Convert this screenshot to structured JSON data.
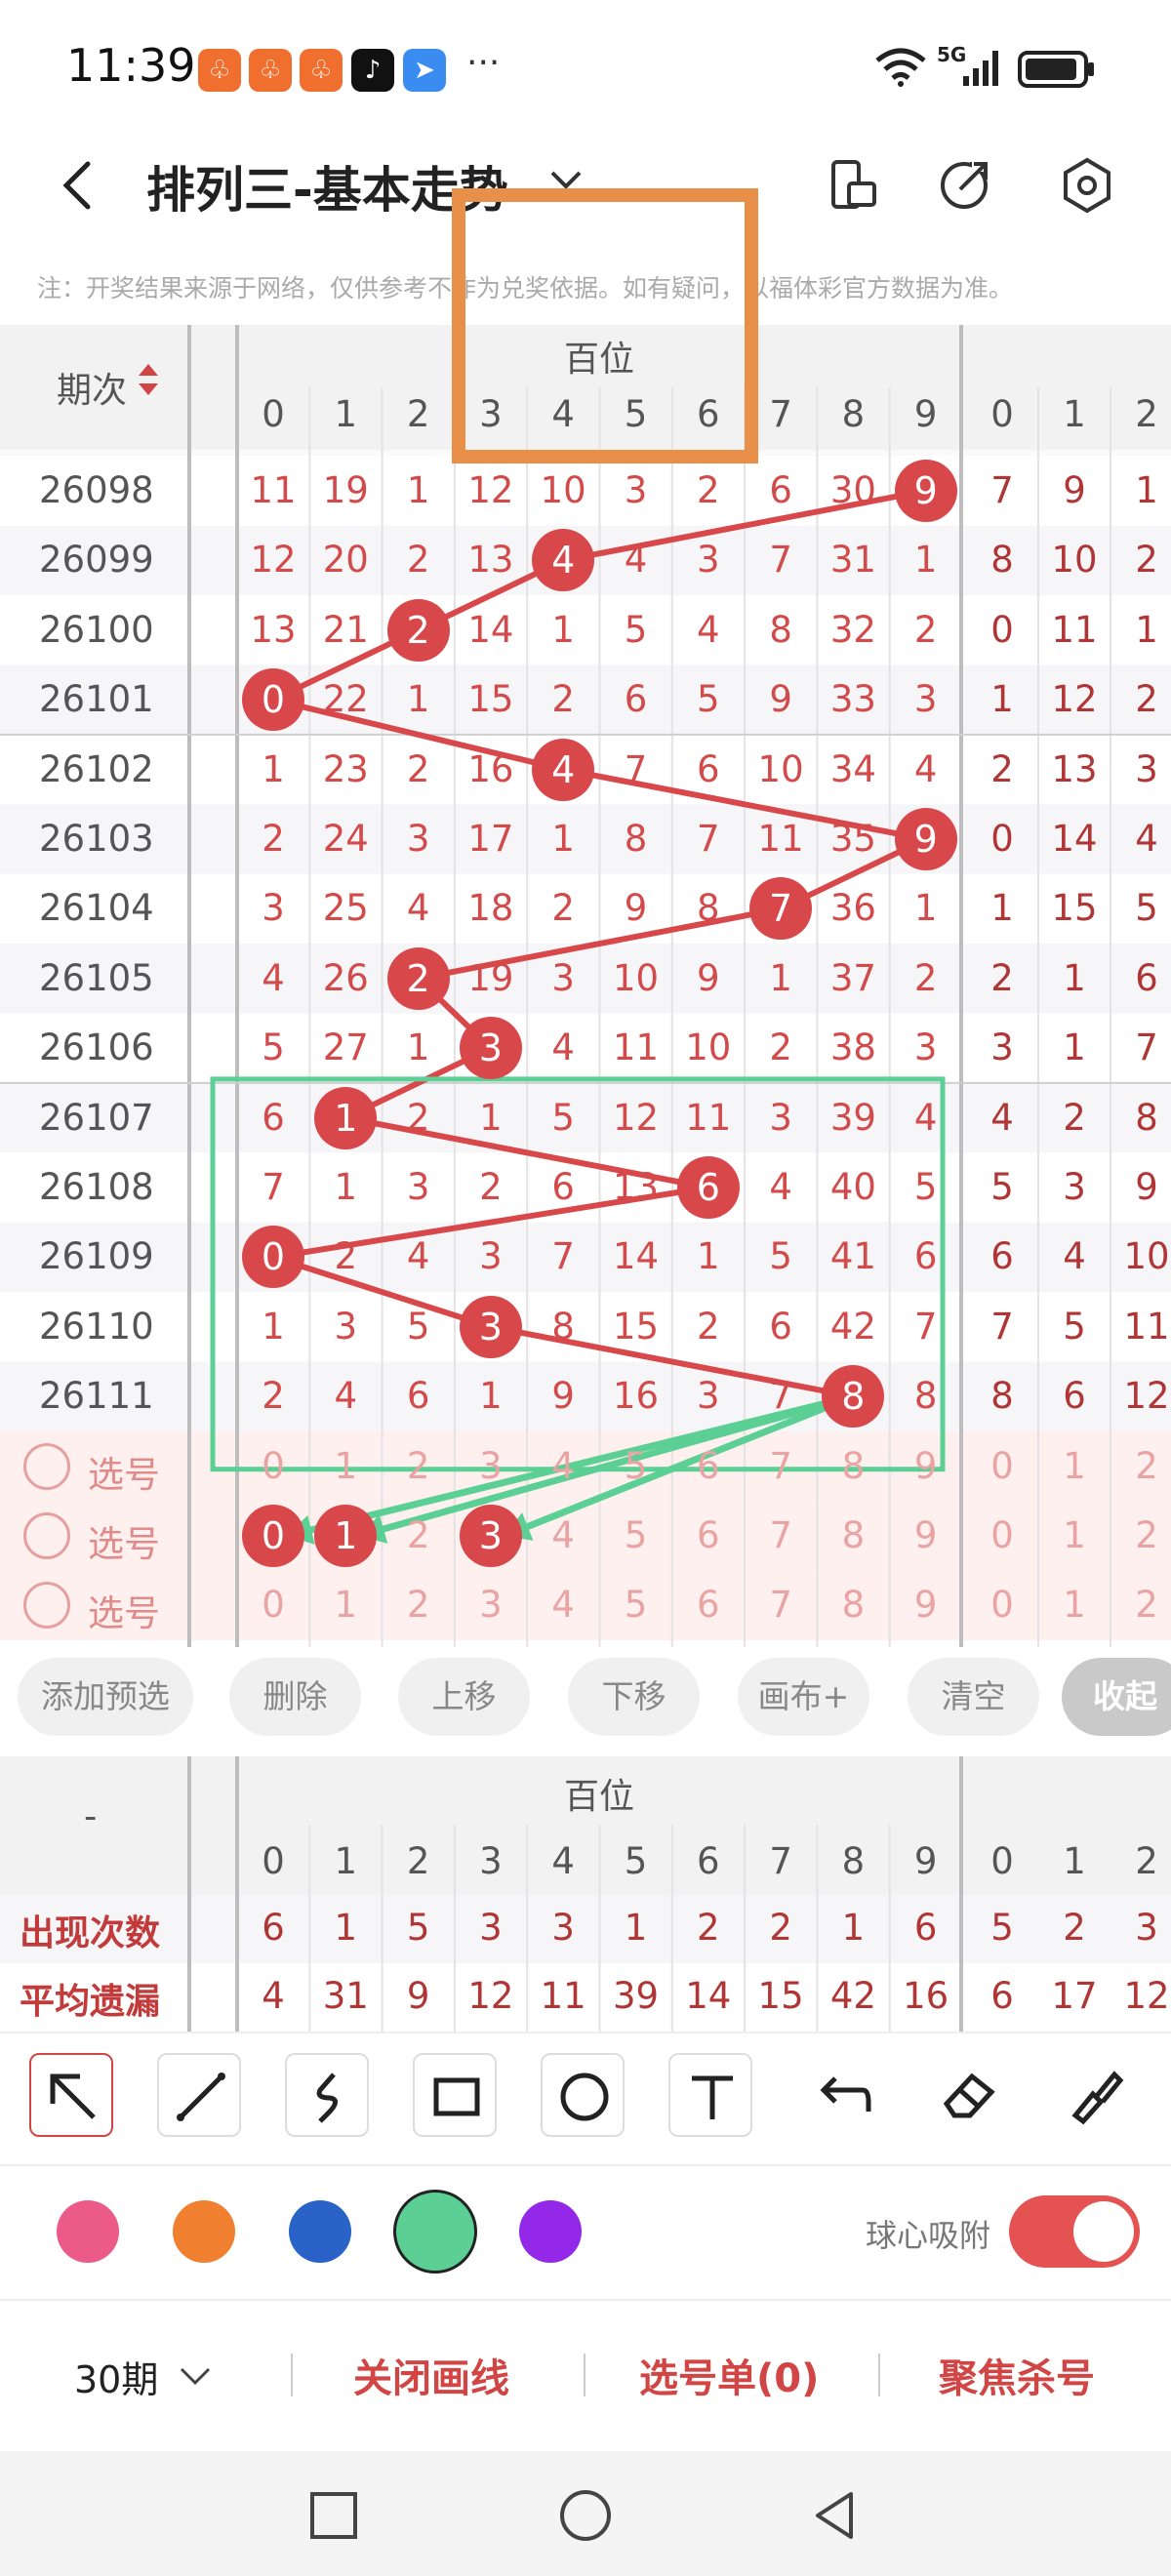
{
  "status_bar": {
    "time": "11:39",
    "more": "···",
    "network": "5G"
  },
  "header": {
    "title": "排列三-基本走势",
    "notice": "注：开奖结果来源于网络，仅供参考不作为兑奖依据。如有疑问，以福体彩官方数据为准。"
  },
  "table": {
    "period_header": "期次",
    "group_label": "百位",
    "digits": [
      "0",
      "1",
      "2",
      "3",
      "4",
      "5",
      "6",
      "7",
      "8",
      "9"
    ],
    "next_digits": [
      "0",
      "1",
      "2"
    ],
    "rows": [
      {
        "period": "26098",
        "cells": [
          "11",
          "19",
          "1",
          "12",
          "10",
          "3",
          "2",
          "6",
          "30",
          "9"
        ],
        "hit": 9,
        "next": [
          "7",
          "9",
          "1"
        ]
      },
      {
        "period": "26099",
        "cells": [
          "12",
          "20",
          "2",
          "13",
          "4",
          "4",
          "3",
          "7",
          "31",
          "1"
        ],
        "hit": 4,
        "next": [
          "8",
          "10",
          "2"
        ]
      },
      {
        "period": "26100",
        "cells": [
          "13",
          "21",
          "2",
          "14",
          "1",
          "5",
          "4",
          "8",
          "32",
          "2"
        ],
        "hit": 2,
        "next": [
          "0",
          "11",
          "1"
        ]
      },
      {
        "period": "26101",
        "cells": [
          "0",
          "22",
          "1",
          "15",
          "2",
          "6",
          "5",
          "9",
          "33",
          "3"
        ],
        "hit": 0,
        "next": [
          "1",
          "12",
          "2"
        ]
      },
      {
        "period": "26102",
        "cells": [
          "1",
          "23",
          "2",
          "16",
          "4",
          "7",
          "6",
          "10",
          "34",
          "4"
        ],
        "hit": 4,
        "next": [
          "2",
          "13",
          "3"
        ]
      },
      {
        "period": "26103",
        "cells": [
          "2",
          "24",
          "3",
          "17",
          "1",
          "8",
          "7",
          "11",
          "35",
          "9"
        ],
        "hit": 9,
        "next": [
          "0",
          "14",
          "4"
        ]
      },
      {
        "period": "26104",
        "cells": [
          "3",
          "25",
          "4",
          "18",
          "2",
          "9",
          "8",
          "7",
          "36",
          "1"
        ],
        "hit": 7,
        "next": [
          "1",
          "15",
          "5"
        ]
      },
      {
        "period": "26105",
        "cells": [
          "4",
          "26",
          "2",
          "19",
          "3",
          "10",
          "9",
          "1",
          "37",
          "2"
        ],
        "hit": 2,
        "next": [
          "2",
          "1",
          "6"
        ]
      },
      {
        "period": "26106",
        "cells": [
          "5",
          "27",
          "1",
          "3",
          "4",
          "11",
          "10",
          "2",
          "38",
          "3"
        ],
        "hit": 3,
        "next": [
          "3",
          "1",
          "7"
        ]
      },
      {
        "period": "26107",
        "cells": [
          "6",
          "1",
          "2",
          "1",
          "5",
          "12",
          "11",
          "3",
          "39",
          "4"
        ],
        "hit": 1,
        "next": [
          "4",
          "2",
          "8"
        ]
      },
      {
        "period": "26108",
        "cells": [
          "7",
          "1",
          "3",
          "2",
          "6",
          "13",
          "6",
          "4",
          "40",
          "5"
        ],
        "hit": 6,
        "next": [
          "5",
          "3",
          "9"
        ]
      },
      {
        "period": "26109",
        "cells": [
          "0",
          "2",
          "4",
          "3",
          "7",
          "14",
          "1",
          "5",
          "41",
          "6"
        ],
        "hit": 0,
        "next": [
          "6",
          "4",
          "10"
        ]
      },
      {
        "period": "26110",
        "cells": [
          "1",
          "3",
          "5",
          "3",
          "8",
          "15",
          "2",
          "6",
          "42",
          "7"
        ],
        "hit": 3,
        "next": [
          "7",
          "5",
          "11"
        ]
      },
      {
        "period": "26111",
        "cells": [
          "2",
          "4",
          "6",
          "1",
          "9",
          "16",
          "3",
          "7",
          "8",
          "8"
        ],
        "hit": 8,
        "next": [
          "8",
          "6",
          "12"
        ]
      }
    ],
    "select_label": "选号",
    "select_rows": [
      {
        "picked": []
      },
      {
        "picked": [
          0,
          1,
          3
        ]
      },
      {
        "picked": []
      }
    ]
  },
  "actions": {
    "add_preselect": "添加预选",
    "delete": "删除",
    "move_up": "上移",
    "move_down": "下移",
    "canvas_plus": "画布+",
    "clear": "清空",
    "collapse": "收起"
  },
  "stats": {
    "corner": "-",
    "group_label": "百位",
    "appear_label": "出现次数",
    "avg_miss_label": "平均遗漏",
    "appear": [
      "6",
      "1",
      "5",
      "3",
      "3",
      "1",
      "2",
      "2",
      "1",
      "6"
    ],
    "appear_next": [
      "5",
      "2",
      "3"
    ],
    "avg_miss": [
      "4",
      "31",
      "9",
      "12",
      "11",
      "39",
      "14",
      "15",
      "42",
      "16"
    ],
    "avg_miss_next": [
      "6",
      "17",
      "12"
    ]
  },
  "draw_toolbar": {
    "snap_label": "球心吸附",
    "colors": [
      "#ec5a8a",
      "#f08030",
      "#2a62c8",
      "#5ccf95",
      "#9428e8"
    ]
  },
  "bottom": {
    "periods": "30期",
    "close_lines": "关闭画线",
    "pick_list": "选号单(0)",
    "focus_kill": "聚焦杀号"
  }
}
